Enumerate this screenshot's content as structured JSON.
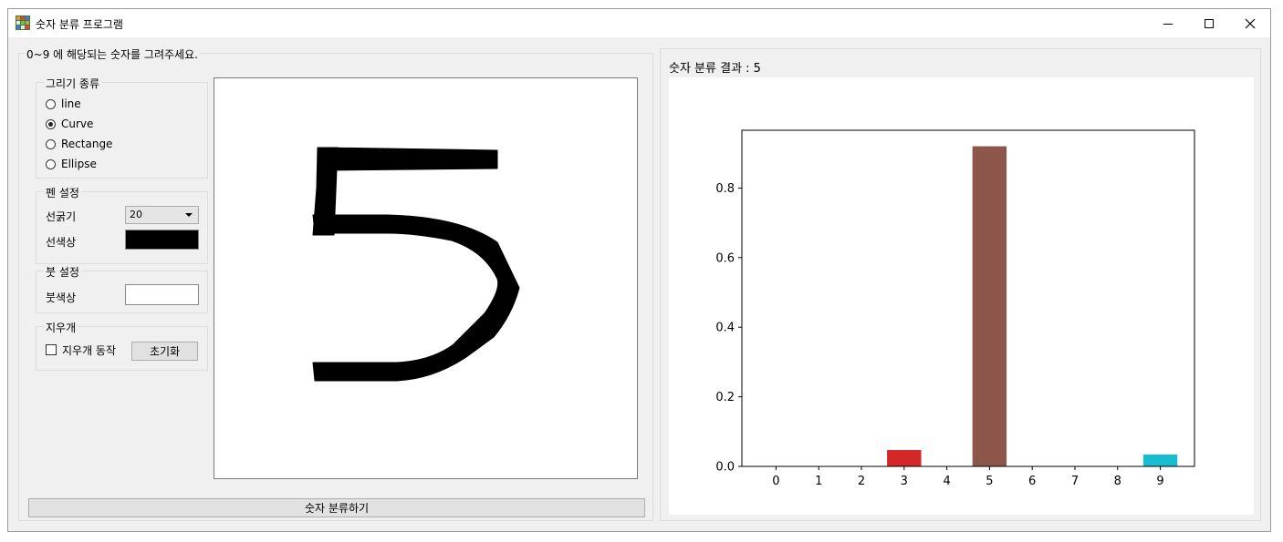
{
  "window": {
    "title": "숫자 분류 프로그램",
    "app_icon": "app-grid-icon"
  },
  "left_panel": {
    "legend": "0~9 에 해당되는 숫자를 그려주세요.",
    "draw_type": {
      "legend": "그리기 종류",
      "options": [
        {
          "label": "line",
          "checked": false
        },
        {
          "label": "Curve",
          "checked": true
        },
        {
          "label": "Rectange",
          "checked": false
        },
        {
          "label": "Ellipse",
          "checked": false
        }
      ]
    },
    "pen": {
      "legend": "펜 설정",
      "width_label": "선굵기",
      "width_value": "20",
      "color_label": "선색상",
      "color": "#000000"
    },
    "brush": {
      "legend": "붓 설정",
      "color_label": "붓색상",
      "color": "#ffffff"
    },
    "eraser": {
      "legend": "지우개",
      "toggle_label": "지우개 동작",
      "toggle_checked": false,
      "reset_label": "초기화"
    },
    "drawn_digit": "5",
    "classify_button": "숫자 분류하기"
  },
  "right_panel": {
    "result_text": "숫자 분류 결과 : 5"
  },
  "chart_data": {
    "type": "bar",
    "categories": [
      "0",
      "1",
      "2",
      "3",
      "4",
      "5",
      "6",
      "7",
      "8",
      "9"
    ],
    "values": [
      0.0,
      0.0,
      0.0,
      0.047,
      0.0,
      0.92,
      0.0,
      0.0,
      0.0,
      0.034
    ],
    "colors": [
      "#1f77b4",
      "#ff7f0e",
      "#2ca02c",
      "#d62728",
      "#9467bd",
      "#8c564b",
      "#e377c2",
      "#7f7f7f",
      "#bcbd22",
      "#17becf"
    ],
    "yticks": [
      "0.0",
      "0.2",
      "0.4",
      "0.6",
      "0.8"
    ],
    "ylim": [
      0,
      0.966
    ],
    "title": "",
    "xlabel": "",
    "ylabel": "",
    "grid": false
  }
}
